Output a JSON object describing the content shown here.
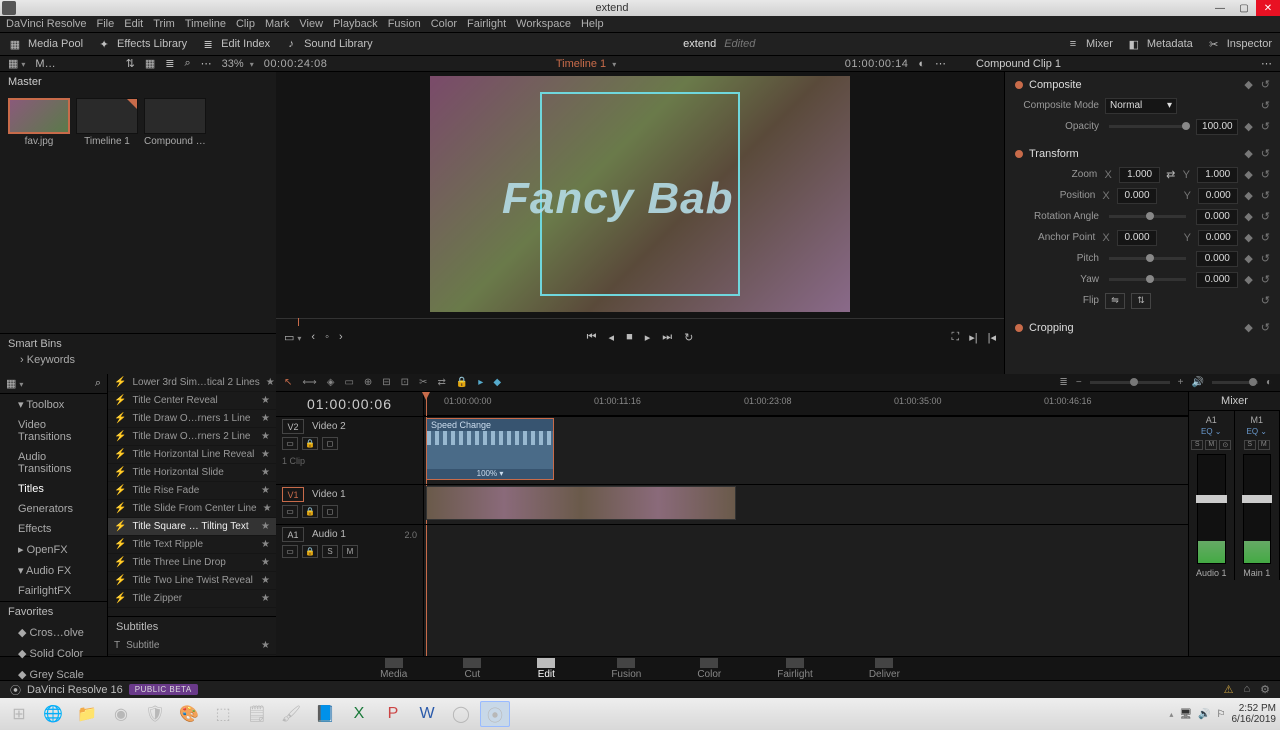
{
  "window": {
    "title": "extend"
  },
  "menu": [
    "DaVinci Resolve",
    "File",
    "Edit",
    "Trim",
    "Timeline",
    "Clip",
    "Mark",
    "View",
    "Playback",
    "Fusion",
    "Color",
    "Fairlight",
    "Workspace",
    "Help"
  ],
  "toolbar": {
    "media_pool": "Media Pool",
    "effects_library": "Effects Library",
    "edit_index": "Edit Index",
    "sound_library": "Sound Library",
    "project": "extend",
    "project_state": "Edited",
    "mixer": "Mixer",
    "metadata": "Metadata",
    "inspector": "Inspector"
  },
  "browserbar": {
    "left_label": "M…",
    "zoom": "33%",
    "duration": "00:00:24:08",
    "timeline_name": "Timeline 1",
    "viewer_tc": "01:00:00:14"
  },
  "media_pool": {
    "header": "Master",
    "thumbs": [
      {
        "label": "fav.jpg",
        "selected": true
      },
      {
        "label": "Timeline 1",
        "corner": true
      },
      {
        "label": "Compound Clip 1"
      }
    ],
    "smart_bins": "Smart Bins",
    "keywords": "Keywords"
  },
  "viewer": {
    "overlay_text": "Fancy Bab"
  },
  "inspector": {
    "header": "Compound Clip 1",
    "composite": {
      "title": "Composite",
      "mode_label": "Composite Mode",
      "mode_value": "Normal",
      "opacity_label": "Opacity",
      "opacity_value": "100.00"
    },
    "transform": {
      "title": "Transform",
      "zoom_label": "Zoom",
      "zoom_x": "1.000",
      "zoom_y": "1.000",
      "position_label": "Position",
      "pos_x": "0.000",
      "pos_y": "0.000",
      "rotation_label": "Rotation Angle",
      "rotation": "0.000",
      "anchor_label": "Anchor Point",
      "anchor_x": "0.000",
      "anchor_y": "0.000",
      "pitch_label": "Pitch",
      "pitch": "0.000",
      "yaw_label": "Yaw",
      "yaw": "0.000",
      "flip_label": "Flip"
    },
    "cropping": {
      "title": "Cropping"
    }
  },
  "lists": {
    "toolbox": "Toolbox",
    "left": [
      {
        "name": "Video Transitions"
      },
      {
        "name": "Audio Transitions"
      },
      {
        "name": "Titles",
        "active": true
      },
      {
        "name": "Generators"
      },
      {
        "name": "Effects"
      }
    ],
    "openfx": "OpenFX",
    "audiofx": "Audio FX",
    "fairlightfx": "FairlightFX",
    "favorites": "Favorites",
    "fav_items": [
      "Cros…olve",
      "Solid Color",
      "Grey Scale"
    ],
    "titles": [
      "Lower 3rd Sim…tical 2 Lines",
      "Title Center Reveal",
      "Title Draw O…rners 1 Line",
      "Title Draw O…rners 2 Line",
      "Title Horizontal Line Reveal",
      "Title Horizontal Slide",
      "Title Rise Fade",
      "Title Slide From Center Line",
      "Title Square … Tilting Text",
      "Title Text Ripple",
      "Title Three Line Drop",
      "Title Two Line Twist Reveal",
      "Title Zipper"
    ],
    "titles_selected": 8,
    "subtitles_head": "Subtitles",
    "subtitle_item": "Subtitle"
  },
  "timeline": {
    "tc": "01:00:00:06",
    "ruler": [
      "01:00:00:00",
      "01:00:11:16",
      "01:00:23:08",
      "01:00:35:00",
      "01:00:46:16"
    ],
    "v2": {
      "id": "V2",
      "name": "Video 2",
      "clip_label": "Speed Change",
      "clip_footer": "100% ▾"
    },
    "v2_subtitle": "1 Clip",
    "v1": {
      "id": "V1",
      "name": "Video 1"
    },
    "a1": {
      "id": "A1",
      "name": "Audio 1",
      "ch": "2.0"
    }
  },
  "mixer": {
    "title": "Mixer",
    "cols": [
      {
        "id": "A1",
        "name": "Audio 1",
        "eq": "EQ ⌄"
      },
      {
        "id": "M1",
        "name": "Main 1",
        "eq": "EQ ⌄"
      }
    ]
  },
  "pages": [
    "Media",
    "Cut",
    "Edit",
    "Fusion",
    "Color",
    "Fairlight",
    "Deliver"
  ],
  "pages_active": 2,
  "status": {
    "brand": "DaVinci Resolve 16",
    "badge": "PUBLIC BETA"
  },
  "taskbar": {
    "tray_time": "2:52 PM",
    "tray_date": "6/16/2019"
  }
}
